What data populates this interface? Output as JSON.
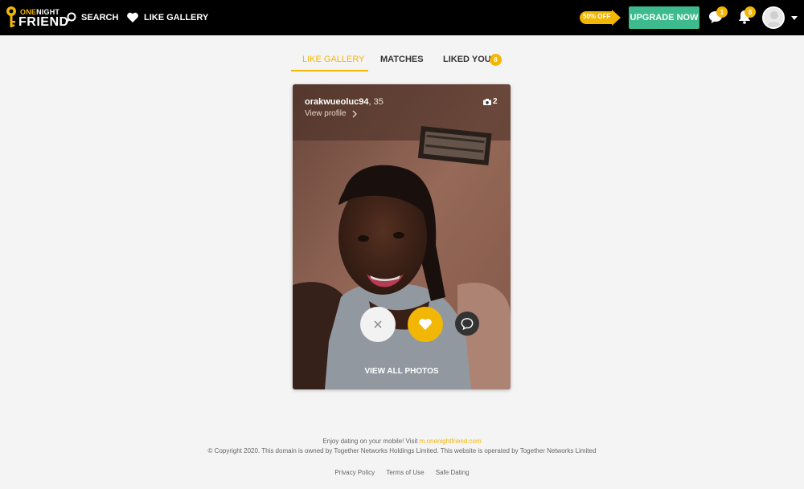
{
  "header": {
    "logo": {
      "line1_a": "ONE",
      "line1_b": "NIGHT",
      "line2": "FRIEND"
    },
    "nav": [
      {
        "label": "SEARCH",
        "icon": "search-icon"
      },
      {
        "label": "LIKE GALLERY",
        "icon": "heart-icon"
      }
    ],
    "promo": "50% OFF",
    "upgrade_label": "UPGRADE NOW",
    "messages_badge": "1",
    "notifications_badge": "8",
    "colors": {
      "bar": "#000000",
      "accent": "#f2b705",
      "upgrade": "#3dba8e"
    }
  },
  "tabs": [
    {
      "label": "LIKE GALLERY",
      "active": true
    },
    {
      "label": "MATCHES",
      "active": false
    },
    {
      "label": "LIKED YOU",
      "active": false
    }
  ],
  "liked_you_count": "8",
  "card": {
    "username": "orakwueoluc94",
    "age": ", 35",
    "view_profile": "View profile",
    "photo_count": "2",
    "view_all": "VIEW ALL PHOTOS",
    "actions": [
      "close-icon",
      "heart-icon",
      "chat-icon"
    ]
  },
  "footer": {
    "mobile_text": "Enjoy dating on your mobile! Visit",
    "mobile_link": "m.onenightfriend.com",
    "copyright": "© Copyright 2020. This domain is owned by Together Networks Holdings Limited. This website is operated by Together Networks Limited",
    "links": [
      "Privacy Policy",
      "Terms of Use",
      "Safe Dating"
    ]
  }
}
